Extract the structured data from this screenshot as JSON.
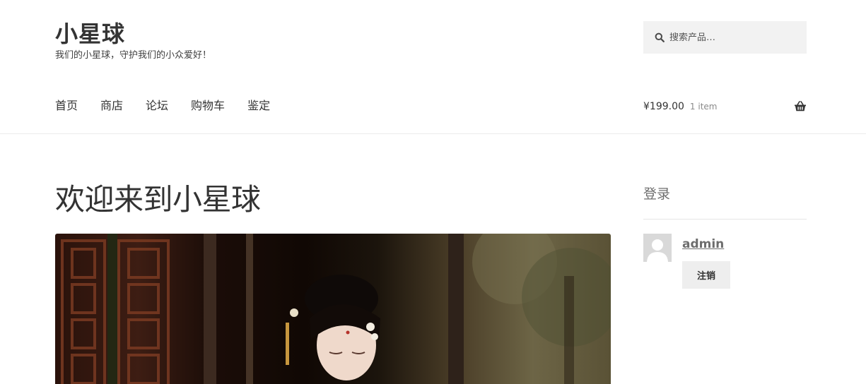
{
  "site": {
    "title": "小星球",
    "description": "我们的小星球，守护我们的小众爱好！"
  },
  "search": {
    "placeholder": "搜索产品…",
    "icon": "search-icon"
  },
  "nav": {
    "items": [
      {
        "label": "首页"
      },
      {
        "label": "商店"
      },
      {
        "label": "论坛"
      },
      {
        "label": "购物车"
      },
      {
        "label": "鉴定"
      }
    ]
  },
  "cart": {
    "amount": "¥199.00",
    "count": "1 item",
    "icon": "basket-icon"
  },
  "main": {
    "title": "欢迎来到小星球"
  },
  "sidebar": {
    "widget_title": "登录",
    "username": "admin",
    "logout_label": "注销"
  },
  "colors": {
    "text": "#333333",
    "muted": "#6d6d6d",
    "search_bg": "#f2f2f2",
    "button_bg": "#eeeeee",
    "divider": "#ebebeb"
  }
}
